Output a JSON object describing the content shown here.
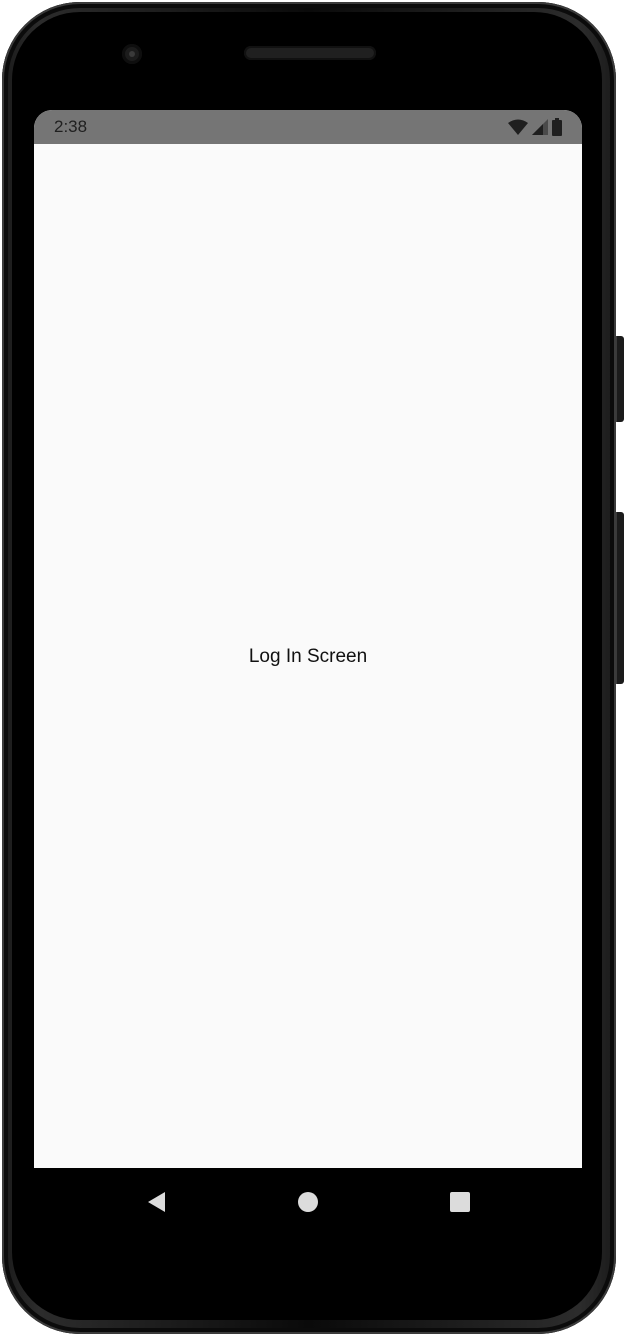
{
  "status_bar": {
    "time": "2:38",
    "icons": [
      "wifi-icon",
      "cellular-signal-icon",
      "battery-icon"
    ],
    "background_color": "#757575"
  },
  "screen": {
    "background_color": "#fafafa",
    "label": "Log In Screen"
  },
  "nav_bar": {
    "buttons": [
      "back-icon",
      "home-icon",
      "recents-icon"
    ]
  }
}
